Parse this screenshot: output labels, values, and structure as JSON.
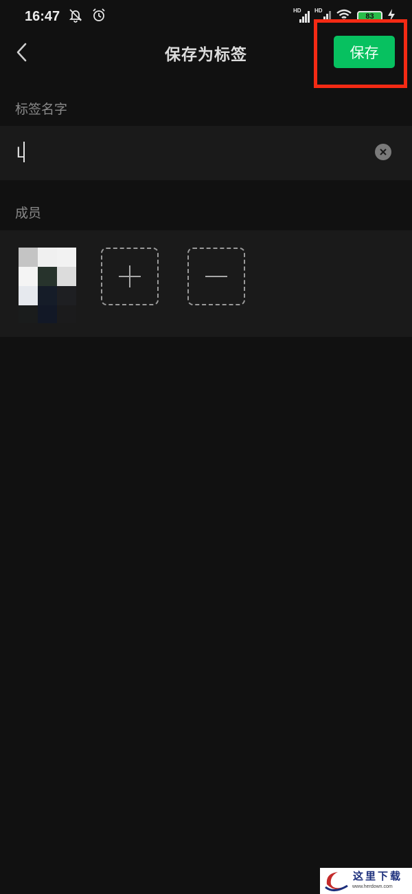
{
  "status_bar": {
    "time": "16:47",
    "network_label_1": "HD",
    "network_label_2": "HD",
    "battery_level": "83",
    "icons": [
      "mute-notification-icon",
      "alarm-icon",
      "signal-icon",
      "signal-icon",
      "wifi-icon",
      "battery-icon",
      "charging-icon"
    ]
  },
  "header": {
    "title": "保存为标签",
    "save_label": "保存",
    "back_icon": "chevron-left-icon"
  },
  "tag_name": {
    "section_label": "标签名字",
    "value": "L",
    "clear_icon": "clear-icon"
  },
  "members": {
    "section_label": "成员",
    "add_icon": "plus-icon",
    "remove_icon": "minus-icon"
  },
  "watermark": {
    "chars": "这里下载",
    "url": "www.herdown.com"
  },
  "colors": {
    "background": "#111111",
    "panel": "#1a1a1a",
    "accent_green": "#07c160",
    "highlight_red": "#f42a14"
  }
}
